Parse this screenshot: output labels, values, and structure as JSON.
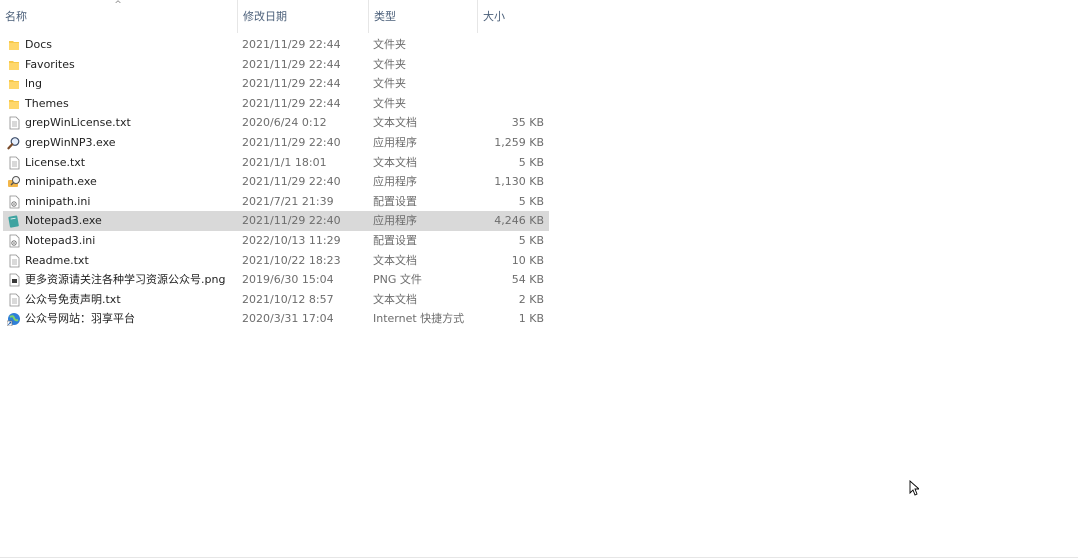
{
  "columns": {
    "name": "名称",
    "date": "修改日期",
    "type": "类型",
    "size": "大小"
  },
  "sort_indicator": "^",
  "files": [
    {
      "name": "Docs",
      "date": "2021/11/29 22:44",
      "type": "文件夹",
      "size": "",
      "icon": "folder-icon"
    },
    {
      "name": "Favorites",
      "date": "2021/11/29 22:44",
      "type": "文件夹",
      "size": "",
      "icon": "folder-icon"
    },
    {
      "name": "lng",
      "date": "2021/11/29 22:44",
      "type": "文件夹",
      "size": "",
      "icon": "folder-icon"
    },
    {
      "name": "Themes",
      "date": "2021/11/29 22:44",
      "type": "文件夹",
      "size": "",
      "icon": "folder-icon"
    },
    {
      "name": "grepWinLicense.txt",
      "date": "2020/6/24 0:12",
      "type": "文本文档",
      "size": "35 KB",
      "icon": "text-file-icon"
    },
    {
      "name": "grepWinNP3.exe",
      "date": "2021/11/29 22:40",
      "type": "应用程序",
      "size": "1,259 KB",
      "icon": "magnifier-app-icon"
    },
    {
      "name": "License.txt",
      "date": "2021/1/1 18:01",
      "type": "文本文档",
      "size": "5 KB",
      "icon": "text-file-icon"
    },
    {
      "name": "minipath.exe",
      "date": "2021/11/29 22:40",
      "type": "应用程序",
      "size": "1,130 KB",
      "icon": "minipath-app-icon"
    },
    {
      "name": "minipath.ini",
      "date": "2021/7/21 21:39",
      "type": "配置设置",
      "size": "5 KB",
      "icon": "settings-file-icon"
    },
    {
      "name": "Notepad3.exe",
      "date": "2021/11/29 22:40",
      "type": "应用程序",
      "size": "4,246 KB",
      "icon": "notepad-app-icon",
      "selected": true
    },
    {
      "name": "Notepad3.ini",
      "date": "2022/10/13 11:29",
      "type": "配置设置",
      "size": "5 KB",
      "icon": "settings-file-icon"
    },
    {
      "name": "Readme.txt",
      "date": "2021/10/22 18:23",
      "type": "文本文档",
      "size": "10 KB",
      "icon": "text-file-icon"
    },
    {
      "name": "更多资源请关注各种学习资源公众号.png",
      "date": "2019/6/30 15:04",
      "type": "PNG 文件",
      "size": "54 KB",
      "icon": "image-file-icon"
    },
    {
      "name": "公众号免责声明.txt",
      "date": "2021/10/12 8:57",
      "type": "文本文档",
      "size": "2 KB",
      "icon": "text-file-icon"
    },
    {
      "name": "公众号网站：羽享平台",
      "date": "2020/3/31 17:04",
      "type": "Internet 快捷方式",
      "size": "1 KB",
      "icon": "internet-shortcut-icon"
    }
  ],
  "colors": {
    "header_text": "#4c607a",
    "selected_row": "#d9d9d9",
    "secondary_text": "#6d6d6d",
    "folder": "#f7c94b"
  }
}
